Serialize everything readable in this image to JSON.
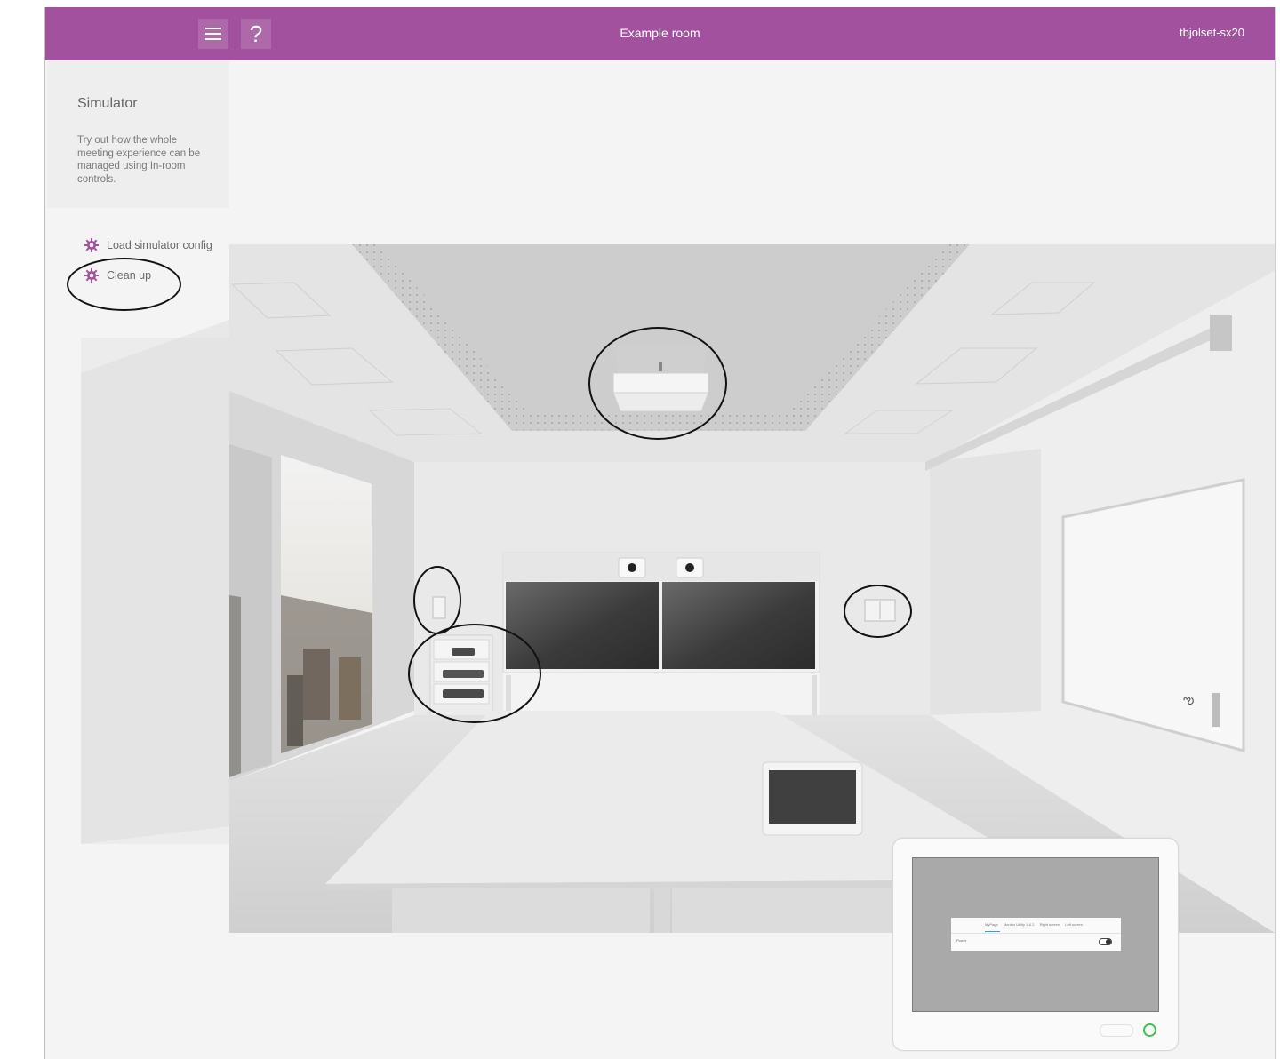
{
  "topbar": {
    "menu_icon": "hamburger-menu-icon",
    "help_label": "?",
    "room_title": "Example room",
    "device_id": "tbjolset-sx20"
  },
  "sidebar": {
    "title": "Simulator",
    "description": "Try out how the whole meeting experience can be managed using In-room controls.",
    "actions": [
      {
        "label": "Load simulator config",
        "icon": "gear-icon"
      },
      {
        "label": "Clean up",
        "icon": "gear-icon"
      }
    ]
  },
  "touch_panel": {
    "tabs": [
      "MyPage",
      "Monitor Utility 1 & 2",
      "Right screen",
      "Left screen"
    ],
    "power_label": "Power",
    "power_on": false
  },
  "colors": {
    "brand": "#a1519d",
    "status_ring": "#3cc34a",
    "tab_underline": "#2e9fd8"
  }
}
